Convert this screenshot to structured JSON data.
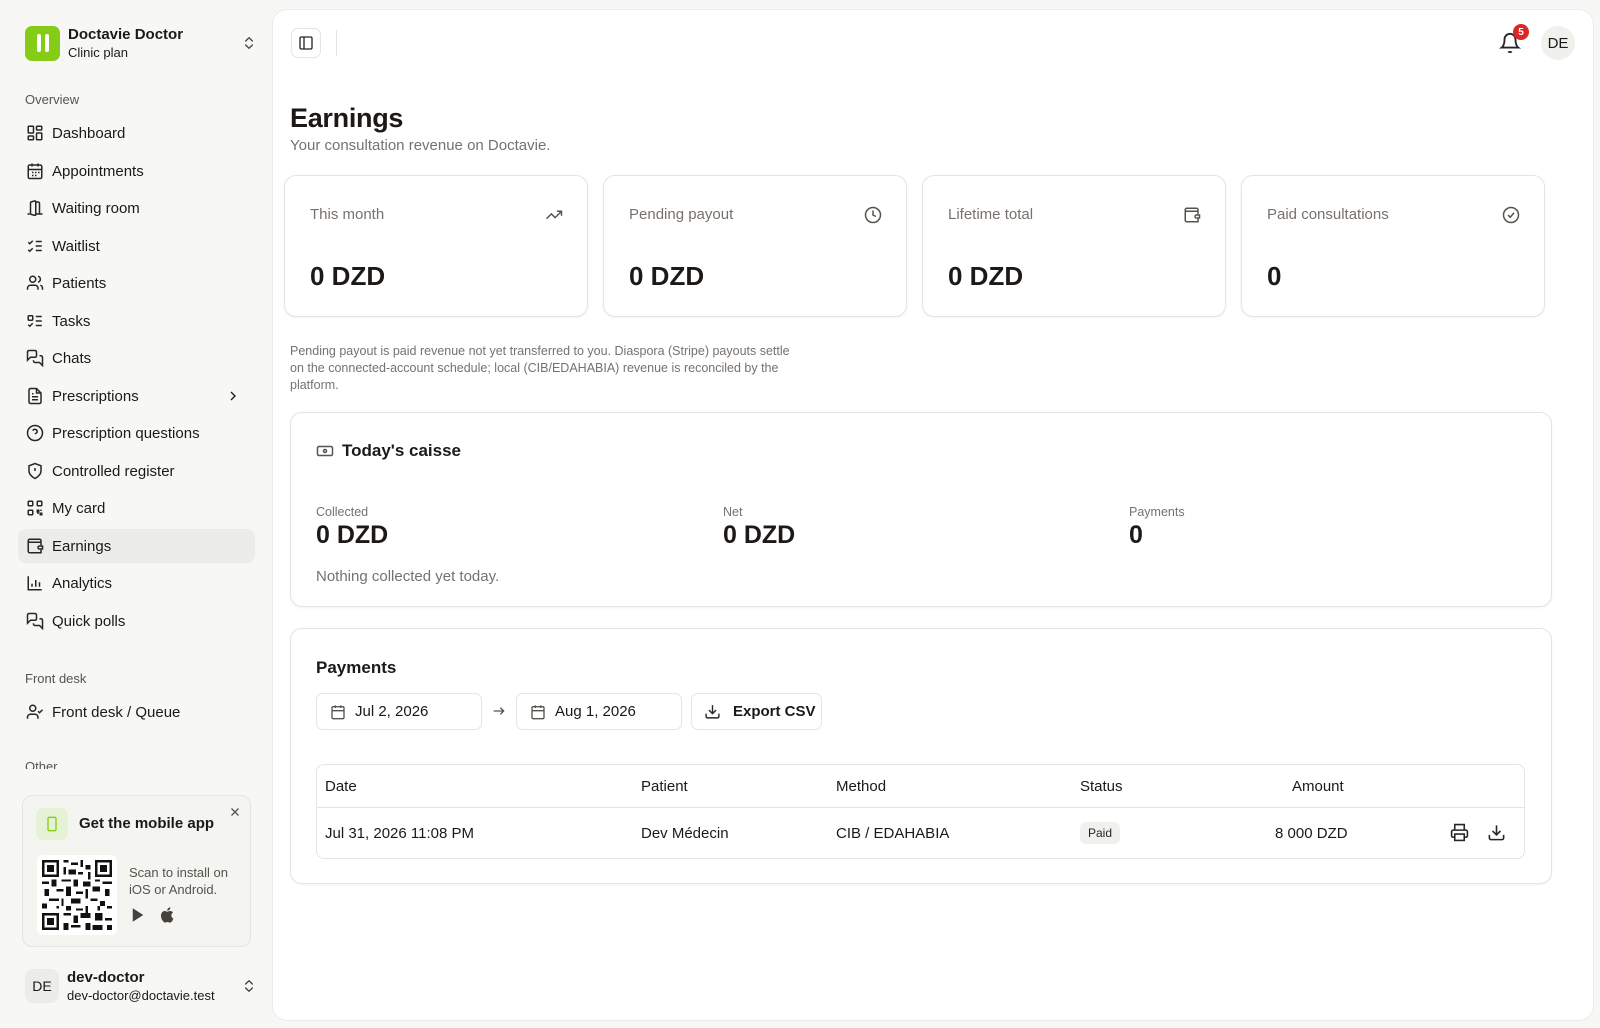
{
  "org": {
    "name": "Doctavie Doctor",
    "plan": "Clinic plan"
  },
  "nav": {
    "overview_label": "Overview",
    "items": [
      {
        "label": "Dashboard"
      },
      {
        "label": "Appointments"
      },
      {
        "label": "Waiting room"
      },
      {
        "label": "Waitlist"
      },
      {
        "label": "Patients"
      },
      {
        "label": "Tasks"
      },
      {
        "label": "Chats"
      },
      {
        "label": "Prescriptions"
      },
      {
        "label": "Prescription questions"
      },
      {
        "label": "Controlled register"
      },
      {
        "label": "My card"
      },
      {
        "label": "Earnings"
      },
      {
        "label": "Analytics"
      },
      {
        "label": "Quick polls"
      }
    ],
    "front_desk_label": "Front desk",
    "front_desk_items": [
      {
        "label": "Front desk / Queue"
      }
    ],
    "other_label": "Other",
    "active": "Earnings"
  },
  "mobile_app": {
    "title": "Get the mobile app",
    "scan_text": "Scan to install on iOS or Android."
  },
  "user": {
    "initials": "DE",
    "name": "dev-doctor",
    "email": "dev-doctor@doctavie.test"
  },
  "topbar": {
    "notification_count": "5",
    "avatar_initials": "DE"
  },
  "page": {
    "title": "Earnings",
    "subtitle": "Your consultation revenue on Doctavie."
  },
  "stats": [
    {
      "label": "This month",
      "value": "0 DZD",
      "icon": "trending-up-icon"
    },
    {
      "label": "Pending payout",
      "value": "0 DZD",
      "icon": "clock-icon"
    },
    {
      "label": "Lifetime total",
      "value": "0 DZD",
      "icon": "wallet-icon"
    },
    {
      "label": "Paid consultations",
      "value": "0",
      "icon": "check-circle-icon"
    }
  ],
  "note": "Pending payout is paid revenue not yet transferred to you. Diaspora (Stripe) payouts settle on the connected-account schedule; local (CIB/EDAHABIA) revenue is reconciled by the platform.",
  "caisse": {
    "title": "Today's caisse",
    "metrics": [
      {
        "label": "Collected",
        "value": "0 DZD"
      },
      {
        "label": "Net",
        "value": "0 DZD"
      },
      {
        "label": "Payments",
        "value": "0"
      }
    ],
    "empty_text": "Nothing collected yet today."
  },
  "payments": {
    "title": "Payments",
    "date_from": "Jul 2, 2026",
    "date_to": "Aug 1, 2026",
    "export_label": "Export CSV",
    "columns": [
      "Date",
      "Patient",
      "Method",
      "Status",
      "Amount"
    ],
    "rows": [
      {
        "date": "Jul 31, 2026 11:08 PM",
        "patient": "Dev Médecin",
        "method": "CIB / EDAHABIA",
        "status": "Paid",
        "amount": "8 000 DZD"
      }
    ]
  },
  "colors": {
    "brand": "#84cc16",
    "badge": "#dc2626",
    "muted": "#78716c"
  }
}
